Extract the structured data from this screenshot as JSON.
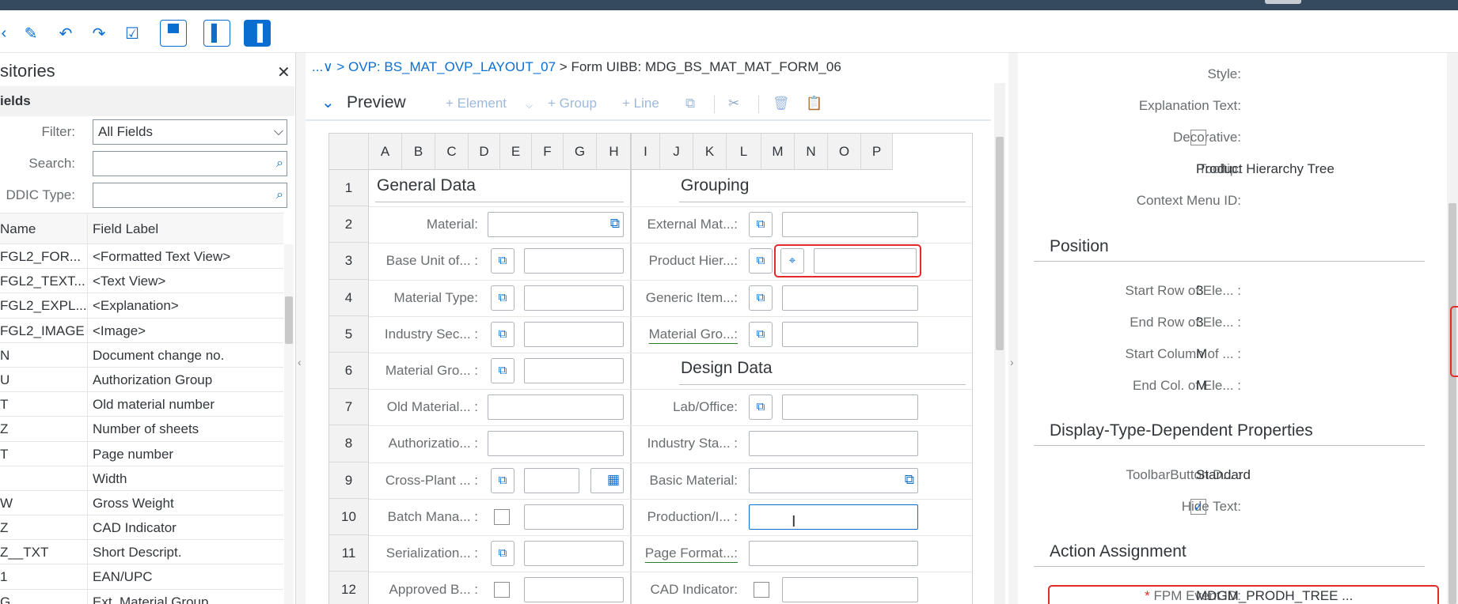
{
  "toolbar": {
    "icons": [
      "back-icon",
      "edit-icon",
      "undo-icon",
      "redo-icon",
      "check-icon",
      "layout-top-icon",
      "layout-left-icon",
      "layout-right-icon"
    ]
  },
  "left_panel": {
    "title": "sitories",
    "subheader": "ields",
    "filter": {
      "label": "Filter:",
      "value": "All Fields"
    },
    "search": {
      "label": "Search:",
      "value": ""
    },
    "ddic": {
      "label": "DDIC Type:",
      "value": ""
    },
    "columns": [
      "Name",
      "Field Label"
    ],
    "rows": [
      {
        "name": "FGL2_FOR...",
        "label": "<Formatted Text View>"
      },
      {
        "name": "FGL2_TEXT...",
        "label": "<Text View>"
      },
      {
        "name": "FGL2_EXPL...",
        "label": "<Explanation>"
      },
      {
        "name": "FGL2_IMAGE",
        "label": "<Image>"
      },
      {
        "name": "N",
        "label": "Document change no."
      },
      {
        "name": "U",
        "label": "Authorization Group"
      },
      {
        "name": "T",
        "label": "Old material number"
      },
      {
        "name": "Z",
        "label": "Number of sheets"
      },
      {
        "name": "T",
        "label": "Page number"
      },
      {
        "name": "",
        "label": "Width"
      },
      {
        "name": "W",
        "label": "Gross Weight"
      },
      {
        "name": "Z",
        "label": "CAD Indicator"
      },
      {
        "name": "Z__TXT",
        "label": "Short Descript."
      },
      {
        "name": "1",
        "label": "EAN/UPC"
      },
      {
        "name": "G",
        "label": "Ext. Material Group"
      }
    ]
  },
  "middle": {
    "breadcrumb": {
      "prefix": "...∨",
      "sep1": ">",
      "link": "OVP: BS_MAT_OVP_LAYOUT_07",
      "rest": "> Form UIBB: MDG_BS_MAT_MAT_FORM_06"
    },
    "preview_title": "Preview",
    "actions": {
      "element": "+ Element",
      "group": "+ Group",
      "line": "+ Line"
    },
    "columns": [
      "A",
      "B",
      "C",
      "D",
      "E",
      "F",
      "G",
      "H",
      "I",
      "J",
      "K",
      "L",
      "M",
      "N",
      "O",
      "P"
    ],
    "rows": [
      "1",
      "2",
      "3",
      "4",
      "5",
      "6",
      "7",
      "8",
      "9",
      "10",
      "11",
      "12"
    ],
    "sections": {
      "general": "General Data",
      "grouping": "Grouping",
      "design": "Design Data"
    },
    "left_labels": [
      "Material:",
      "Base Unit of... :",
      "Material Type:",
      "Industry Sec... :",
      "Material Gro... :",
      "Old Material... :",
      "Authorizatio... :",
      "Cross-Plant ... :",
      "Batch Mana... :",
      "Serialization... :",
      "Approved B... :"
    ],
    "right_labels": [
      "External Mat...:",
      "Product Hier...:",
      "Generic Item...:",
      "Material Gro...:",
      "Lab/Office:",
      "Industry Sta... :",
      "Basic Material:",
      "Production/I... :",
      "Page Format...:",
      "CAD Indicator:"
    ]
  },
  "right_panel": {
    "style_label": "Style:",
    "explanation_label": "Explanation Text:",
    "decorative_label": "Decorative:",
    "tooltip_label": "Tooltip:",
    "tooltip_value": "Product Hierarchy Tree",
    "context_label": "Context Menu ID:",
    "position_title": "Position",
    "start_row_label": "Start Row of Ele... :",
    "start_row_value": "3",
    "end_row_label": "End Row of Ele... :",
    "end_row_value": "3",
    "start_col_label": "Start Column of ... :",
    "start_col_value": "M",
    "end_col_label": "End Col. of Ele... :",
    "end_col_value": "M",
    "display_title": "Display-Type-Dependent Properties",
    "toolbar_btn_label": "ToolbarButton D... :",
    "toolbar_btn_value": "Standard",
    "hide_text_label": "Hide Text:",
    "hide_text_checked": true,
    "action_title": "Action Assignment",
    "fpm_label": "FPM Event ID:",
    "fpm_value": "MDGM_PRODH_TREE ...",
    "required_marker": "*"
  },
  "colors": {
    "accent": "#0a6ed1",
    "highlight": "#e32a2a",
    "shell": "#354a5f"
  }
}
